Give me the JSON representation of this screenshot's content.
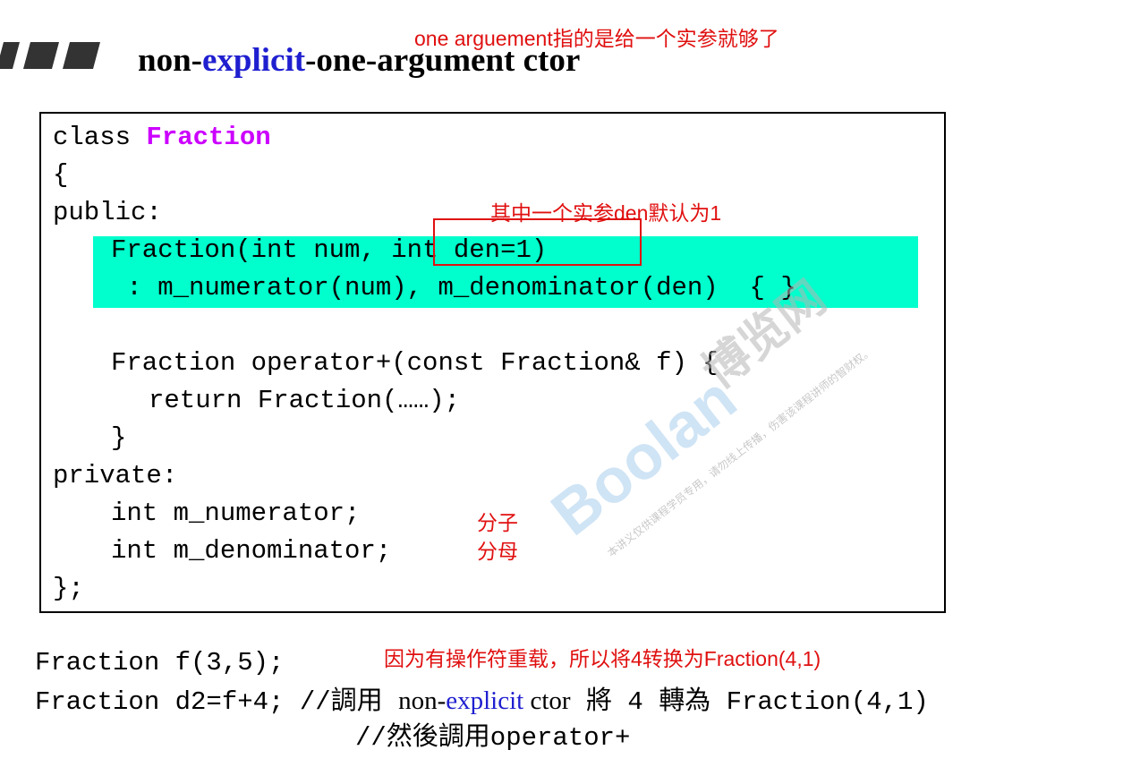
{
  "title": {
    "prefix": "non-",
    "keyword": "explicit",
    "suffix": "-one-argument ctor"
  },
  "annotations": {
    "top_note": "one arguement指的是给一个实参就够了",
    "den_note": "其中一个实参den默认为1",
    "numerator_note": "分子",
    "denominator_note": "分母",
    "overload_note": "因为有操作符重载，所以将4转换为Fraction(4,1)"
  },
  "code": {
    "class_kw": "class ",
    "class_name": "Fraction",
    "open_brace": "{",
    "public": "public:",
    "ctor_line1_a": "Fraction(int num,",
    "ctor_line1_b": " int den=1)",
    "ctor_line2": " : m_numerator(num), m_denominator(den)  { }",
    "op_line1": "Fraction operator+(const Fraction& f) {",
    "op_line2": "return Fraction(……);",
    "op_line3": "}",
    "private": "private:",
    "member1": "int m_numerator;",
    "member2": "int m_denominator;",
    "close": "};"
  },
  "usage": {
    "line1": "Fraction f(3,5);",
    "line2_code": "Fraction d2=f+4;",
    "line2_comment_a": "//調用 ",
    "line2_serif_a": "non-",
    "line2_serif_kw": "explicit",
    "line2_serif_b": " ctor",
    "line2_comment_b": " 將 4 轉為 Fraction(4,1)",
    "line3_comment": "//然後調用operator+"
  },
  "watermark": {
    "brand": "Boolan",
    "cn_name": "博览网",
    "small_text": "本讲义仅供课程学员专用，请勿线上传播，伤害该课程讲师的智财权。"
  },
  "colors": {
    "keyword_blue": "#1f1fd0",
    "class_name_purple": "#cc00ff",
    "annotation_red": "#e01010",
    "highlight": "#00ffcc"
  }
}
